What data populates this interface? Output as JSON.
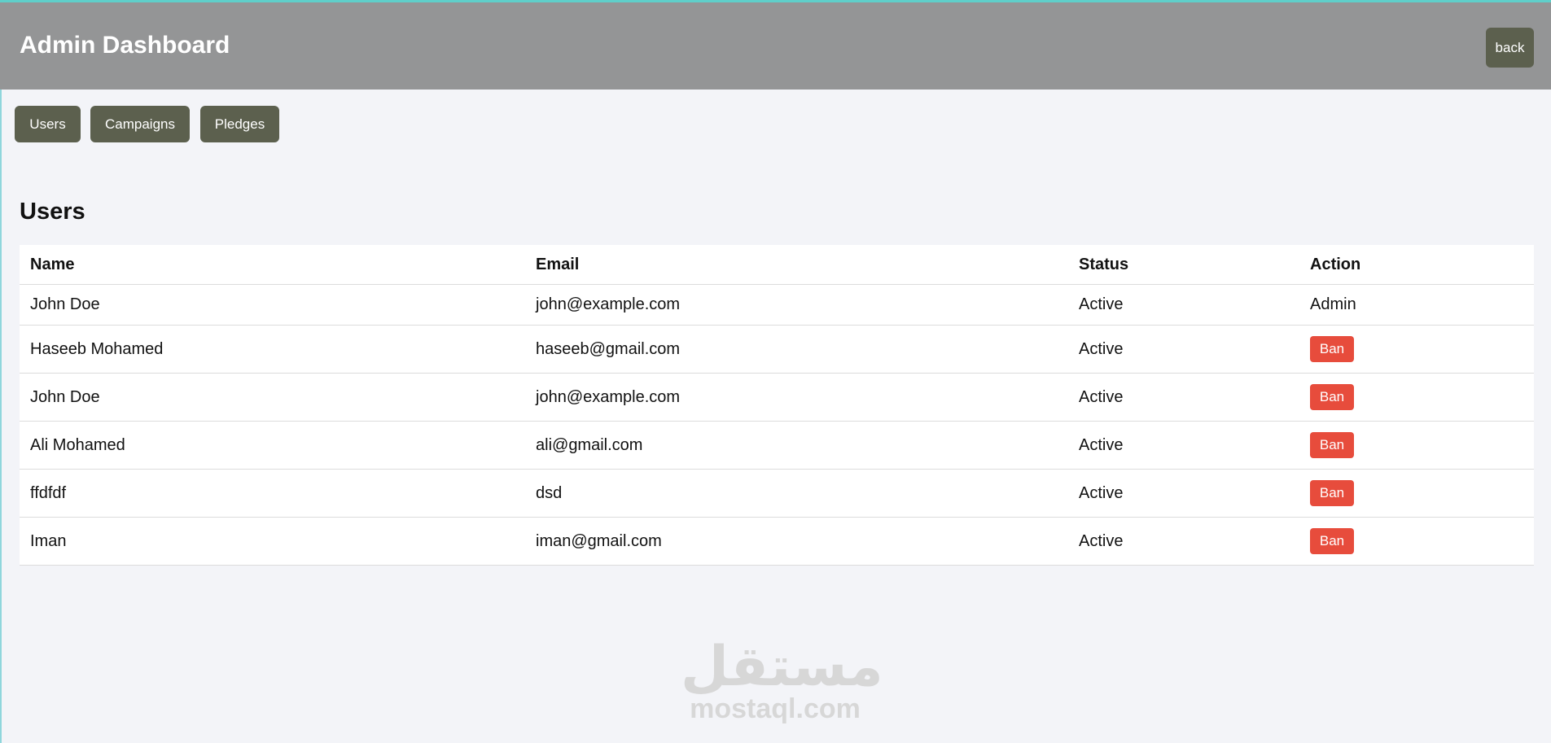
{
  "header": {
    "title": "Admin Dashboard",
    "back_label": "back"
  },
  "tabs": [
    {
      "label": "Users"
    },
    {
      "label": "Campaigns"
    },
    {
      "label": "Pledges"
    }
  ],
  "section": {
    "title": "Users"
  },
  "table": {
    "columns": [
      "Name",
      "Email",
      "Status",
      "Action"
    ],
    "rows": [
      {
        "name": "John Doe",
        "email": "john@example.com",
        "status": "Active",
        "action": "Admin"
      },
      {
        "name": "Haseeb Mohamed",
        "email": "haseeb@gmail.com",
        "status": "Active",
        "action": "Ban"
      },
      {
        "name": "John Doe",
        "email": "john@example.com",
        "status": "Active",
        "action": "Ban"
      },
      {
        "name": "Ali Mohamed",
        "email": "ali@gmail.com",
        "status": "Active",
        "action": "Ban"
      },
      {
        "name": "ffdfdf",
        "email": "dsd",
        "status": "Active",
        "action": "Ban"
      },
      {
        "name": "Iman",
        "email": "iman@gmail.com",
        "status": "Active",
        "action": "Ban"
      }
    ]
  },
  "watermark": {
    "arabic": "مستقل",
    "latin": "mostaql.com"
  },
  "colors": {
    "header_bg": "#949596",
    "button_bg": "#5c604e",
    "ban_bg": "#e74c3c",
    "page_bg": "#f3f4f8",
    "accent_strip": "#5fcfca"
  }
}
